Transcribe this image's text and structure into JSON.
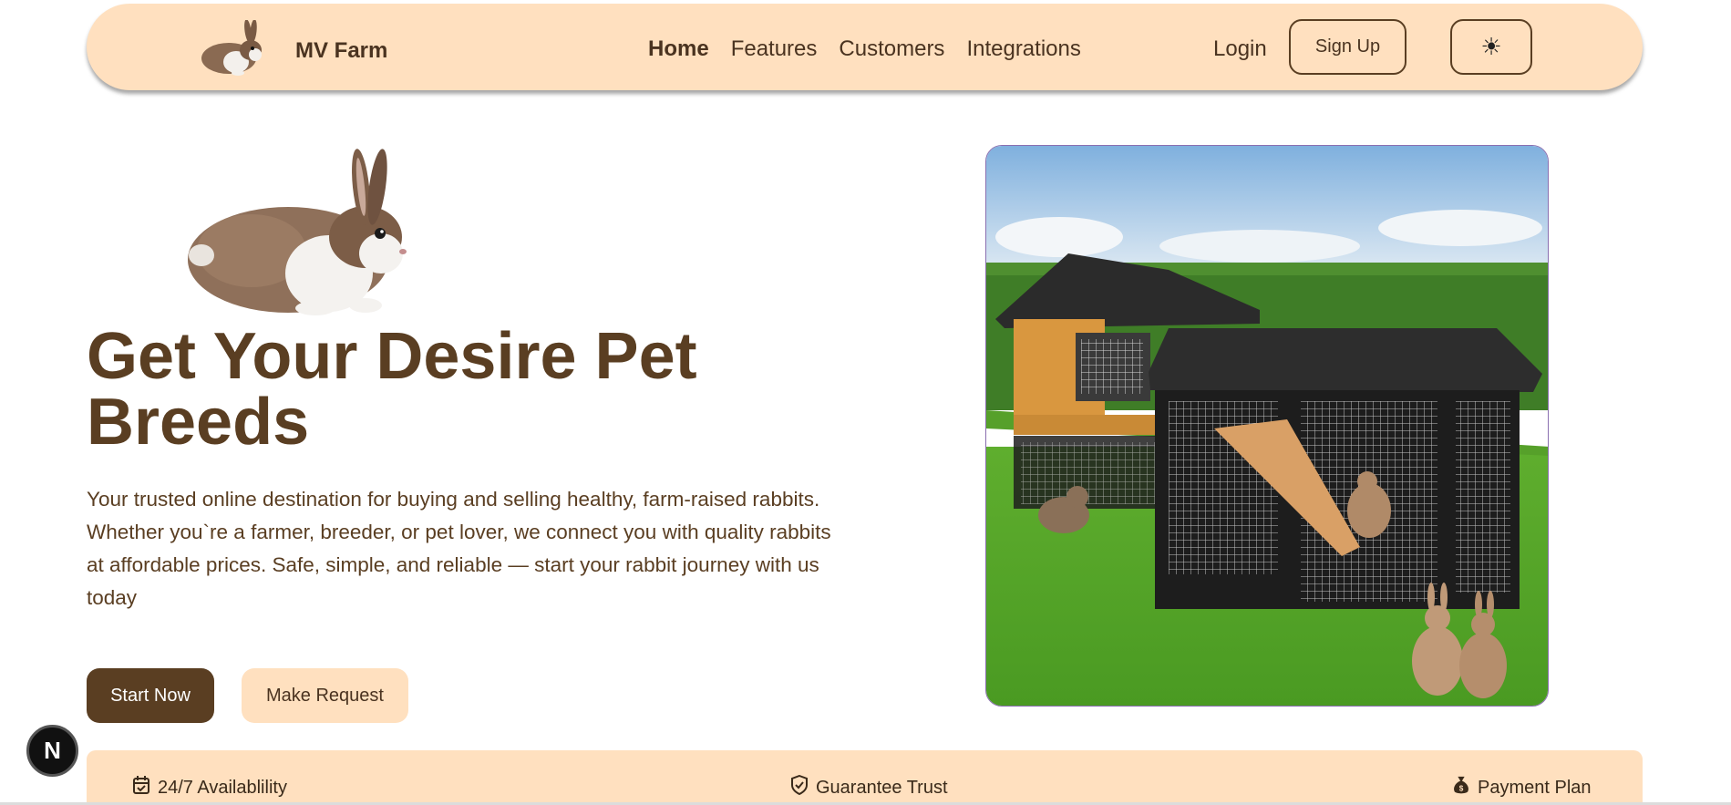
{
  "nav": {
    "brand": "MV Farm",
    "links": [
      "Home",
      "Features",
      "Customers",
      "Integrations"
    ],
    "active_link": "Home",
    "login": "Login",
    "signup": "Sign Up",
    "theme_icon": "sun-icon",
    "theme_glyph": "☀"
  },
  "hero": {
    "title": "Get Your Desire Pet Breeds",
    "description": "Your trusted online destination for buying and selling healthy, farm-raised rabbits. Whether you`re a farmer, breeder, or pet lover, we connect you with quality rabbits at affordable prices. Safe, simple, and reliable — start your rabbit journey with us today",
    "primary_button": "Start Now",
    "secondary_button": "Make Request"
  },
  "features": [
    {
      "icon": "calendar-check-icon",
      "label": "24/7 Availablility"
    },
    {
      "icon": "shield-check-icon",
      "label": "Guarantee Trust"
    },
    {
      "icon": "money-bag-icon",
      "label": "Payment Plan"
    }
  ],
  "badge": {
    "letter": "N"
  },
  "colors": {
    "brand_brown": "#5a3e22",
    "peach": "#ffe0bf",
    "background": "#ffffff"
  }
}
